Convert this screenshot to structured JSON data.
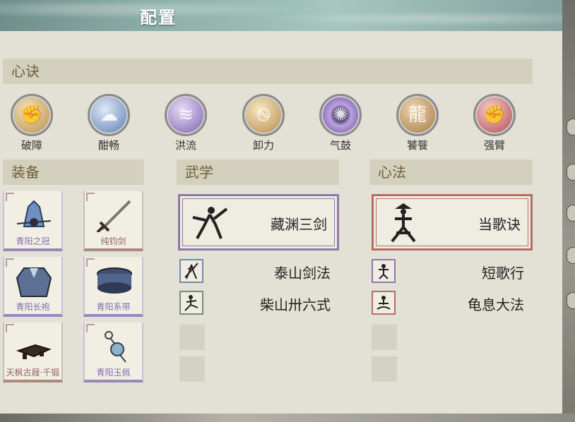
{
  "window": {
    "title": "配置"
  },
  "xinjue": {
    "header": "心诀",
    "items": [
      {
        "label": "破障",
        "icon": "fist-burst-icon",
        "color": "#c9a66b"
      },
      {
        "label": "酣畅",
        "icon": "cloud-swirl-icon",
        "color": "#7f9cc4"
      },
      {
        "label": "洪流",
        "icon": "wave-flow-icon",
        "color": "#9a82c3"
      },
      {
        "label": "卸力",
        "icon": "swirl-deflect-icon",
        "color": "#c9a46b"
      },
      {
        "label": "气鼓",
        "icon": "vortex-icon",
        "color": "#8d6fb8"
      },
      {
        "label": "饕餮",
        "icon": "beast-icon",
        "color": "#b89160"
      },
      {
        "label": "强臂",
        "icon": "raised-fist-icon",
        "color": "#c46f72"
      }
    ]
  },
  "equipment": {
    "header": "装备",
    "items": [
      {
        "name": "青阳之冠",
        "icon": "crown-icon",
        "color": "#7b67a6"
      },
      {
        "name": "纯钧剑",
        "icon": "sword-icon",
        "color": "#8f5d52"
      },
      {
        "name": "青阳长袍",
        "icon": "robe-icon",
        "color": "#7b67a6"
      },
      {
        "name": "青阳系带",
        "icon": "belt-icon",
        "color": "#7b67a6"
      },
      {
        "name": "天枫古屐·千锻",
        "icon": "clogs-icon",
        "color": "#8f5d52"
      },
      {
        "name": "青阳玉佩",
        "icon": "jade-pendant-icon",
        "color": "#7b67a6"
      }
    ]
  },
  "wuxue": {
    "header": "武学",
    "main": {
      "name": "藏渊三剑",
      "icon": "sword-stance-icon"
    },
    "list": [
      {
        "name": "泰山剑法",
        "icon": "swordsman-icon"
      },
      {
        "name": "柴山卅六式",
        "icon": "kick-stance-icon"
      }
    ]
  },
  "xinfa": {
    "header": "心法",
    "main": {
      "name": "当歌诀",
      "icon": "straw-hat-stance-icon"
    },
    "list": [
      {
        "name": "短歌行",
        "icon": "dance-figure-icon"
      },
      {
        "name": "龟息大法",
        "icon": "meditation-figure-icon"
      }
    ]
  }
}
